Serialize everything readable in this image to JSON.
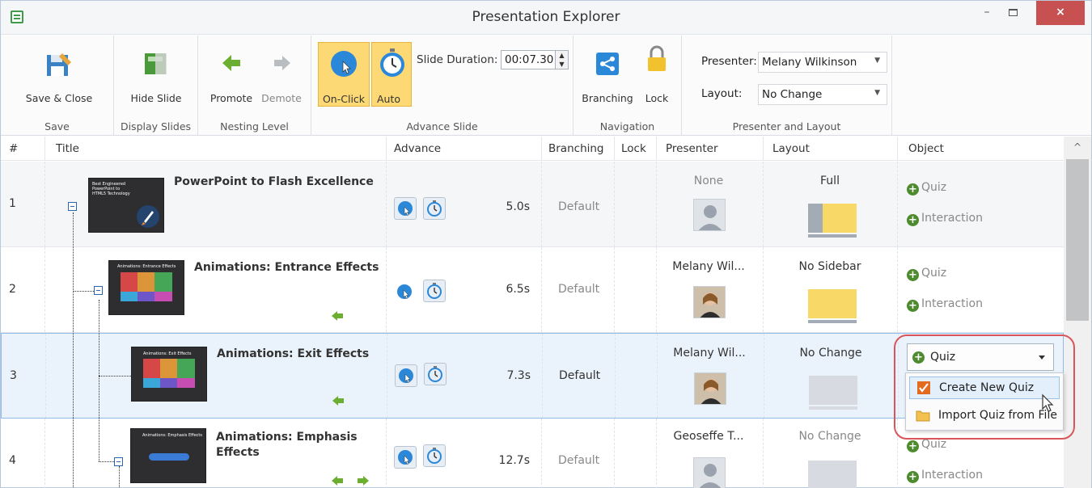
{
  "window": {
    "title": "Presentation Explorer",
    "minimize": "–",
    "close": "×"
  },
  "ribbon": {
    "save_close": "Save & Close",
    "save_group": "Save",
    "hide_slide": "Hide Slide",
    "display_group": "Display Slides",
    "promote": "Promote",
    "demote": "Demote",
    "nesting_group": "Nesting Level",
    "on_click": "On-Click",
    "auto": "Auto",
    "slide_duration_label": "Slide Duration:",
    "slide_duration_value": "00:07.30",
    "advance_group": "Advance Slide",
    "branching": "Branching",
    "lock": "Lock",
    "navigation_group": "Navigation",
    "presenter_label": "Presenter:",
    "presenter_value": "Melany Wilkinson",
    "layout_label": "Layout:",
    "layout_value": "No Change",
    "presenter_group": "Presenter and Layout"
  },
  "columns": {
    "num": "#",
    "title": "Title",
    "advance": "Advance",
    "branching": "Branching",
    "lock": "Lock",
    "presenter": "Presenter",
    "layout": "Layout",
    "object": "Object"
  },
  "rows": [
    {
      "num": "1",
      "title": "PowerPoint to Flash Excellence",
      "duration": "5.0s",
      "branching": "Default",
      "presenter": "None",
      "layout": "Full",
      "obj1": "Quiz",
      "obj2": "Interaction",
      "thumb_text": "Best Engineered PowerPoint to HTML5 Technology"
    },
    {
      "num": "2",
      "title": "Animations: Entrance Effects",
      "duration": "6.5s",
      "branching": "Default",
      "presenter": "Melany Wil...",
      "layout": "No Sidebar",
      "obj1": "Quiz",
      "obj2": "Interaction",
      "thumb_text": "Animations: Entrance Effects"
    },
    {
      "num": "3",
      "title": "Animations: Exit Effects",
      "duration": "7.3s",
      "branching": "Default",
      "presenter": "Melany Wil...",
      "layout": "No Change",
      "thumb_text": "Animations: Exit Effects"
    },
    {
      "num": "4",
      "title": "Animations: Emphasis Effects",
      "duration": "12.7s",
      "branching": "Default",
      "presenter": "Geoseffe T...",
      "layout": "No Change",
      "obj1": "Quiz",
      "obj2": "Interaction",
      "thumb_text": "Animations: Emphasis Effects"
    }
  ],
  "object_dropdown": {
    "selected": "Quiz"
  },
  "menu": {
    "create": "Create New Quiz",
    "import": "Import Quiz from File"
  },
  "colors": {
    "accent_green": "#4e8b2e",
    "selection_blue": "#eaf3fb",
    "highlight_red": "#d9555a",
    "ribbon_active": "#fcd974"
  }
}
